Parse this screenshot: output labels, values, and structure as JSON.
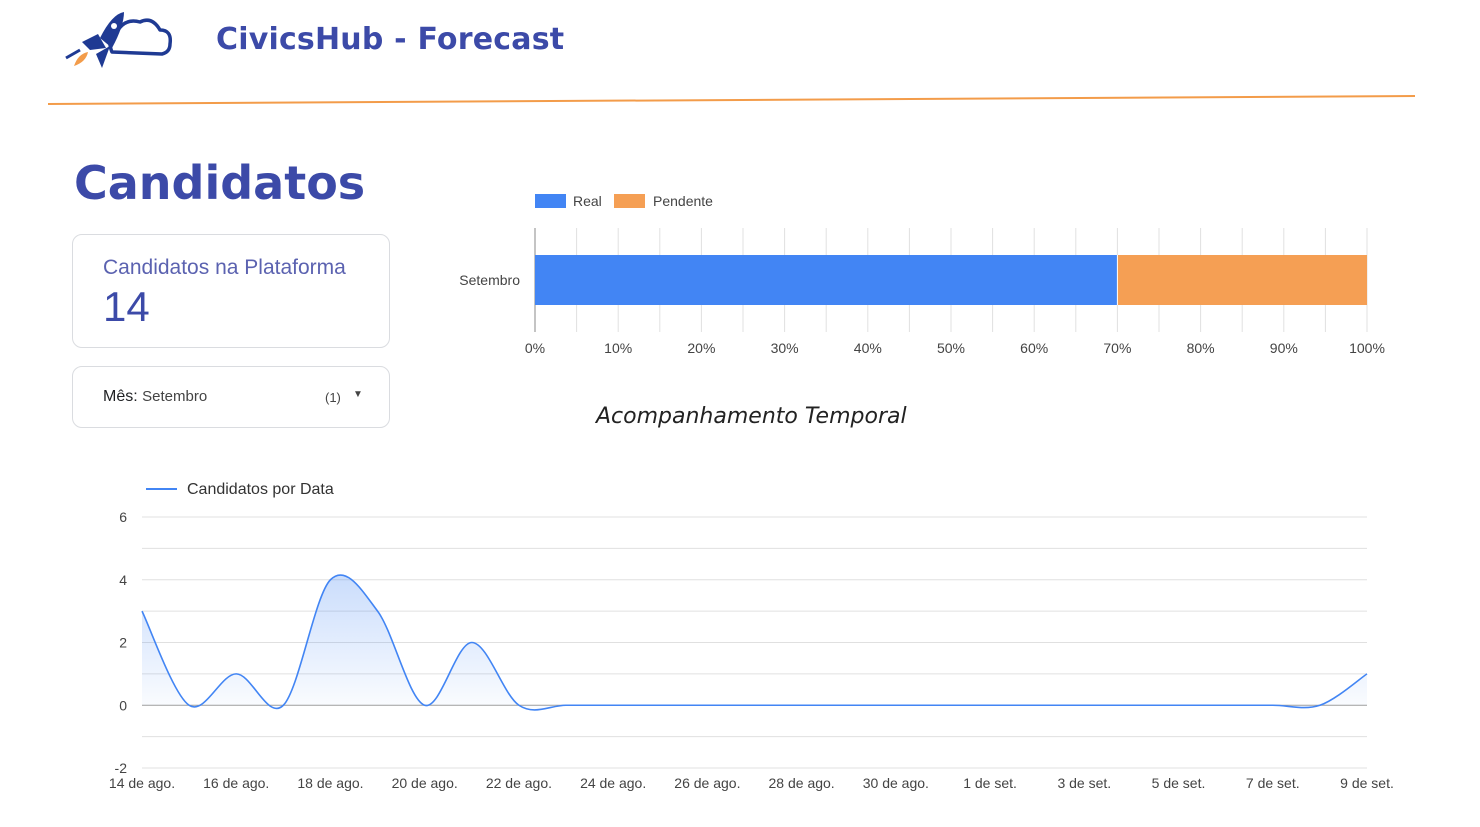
{
  "header": {
    "title": "CivicsHub - Forecast",
    "logo_icon": "rocket-cloud-icon"
  },
  "page": {
    "title": "Candidatos"
  },
  "scorecard": {
    "label": "Candidatos na Plataforma",
    "value": "14"
  },
  "filter": {
    "label": "Mês",
    "value": "Setembro",
    "count": "(1)",
    "icon": "dropdown-arrow-icon"
  },
  "colors": {
    "brand": "#3c4aa8",
    "accent_line": "#f39c4a",
    "real": "#4285f4",
    "pendente": "#f59f54"
  },
  "bar_chart": {
    "legend": [
      "Real",
      "Pendente"
    ],
    "category": "Setembro",
    "ticks": [
      "0%",
      "10%",
      "20%",
      "30%",
      "40%",
      "50%",
      "60%",
      "70%",
      "80%",
      "90%",
      "100%"
    ]
  },
  "line_chart": {
    "title": "Acompanhamento Temporal",
    "legend": "Candidatos por Data",
    "y_ticks": [
      "6",
      "4",
      "2",
      "0",
      "-2"
    ],
    "x_ticks": [
      "14 de ago.",
      "16 de ago.",
      "18 de ago.",
      "20 de ago.",
      "22 de ago.",
      "24 de ago.",
      "26 de ago.",
      "28 de ago.",
      "30 de ago.",
      "1 de set.",
      "3 de set.",
      "5 de set.",
      "7 de set.",
      "9 de set."
    ]
  },
  "chart_data": [
    {
      "type": "bar",
      "orientation": "horizontal",
      "stacked": "percent",
      "categories": [
        "Setembro"
      ],
      "series": [
        {
          "name": "Real",
          "values": [
            70
          ]
        },
        {
          "name": "Pendente",
          "values": [
            30
          ]
        }
      ],
      "xlim": [
        0,
        100
      ],
      "legend_position": "top-left",
      "grid": true
    },
    {
      "type": "area",
      "title": "Acompanhamento Temporal",
      "x": [
        "14 de ago.",
        "15 de ago.",
        "16 de ago.",
        "17 de ago.",
        "18 de ago.",
        "19 de ago.",
        "20 de ago.",
        "21 de ago.",
        "22 de ago.",
        "23 de ago.",
        "24 de ago.",
        "25 de ago.",
        "26 de ago.",
        "27 de ago.",
        "28 de ago.",
        "29 de ago.",
        "30 de ago.",
        "31 de ago.",
        "1 de set.",
        "2 de set.",
        "3 de set.",
        "4 de set.",
        "5 de set.",
        "6 de set.",
        "7 de set.",
        "8 de set.",
        "9 de set."
      ],
      "series": [
        {
          "name": "Candidatos por Data",
          "values": [
            3,
            0,
            1,
            0,
            4,
            3,
            0,
            2,
            0,
            0,
            0,
            0,
            0,
            0,
            0,
            0,
            0,
            0,
            0,
            0,
            0,
            0,
            0,
            0,
            0,
            0,
            1
          ]
        }
      ],
      "ylim": [
        -2,
        6
      ],
      "legend_position": "top-left",
      "grid": true,
      "smooth": true
    }
  ]
}
